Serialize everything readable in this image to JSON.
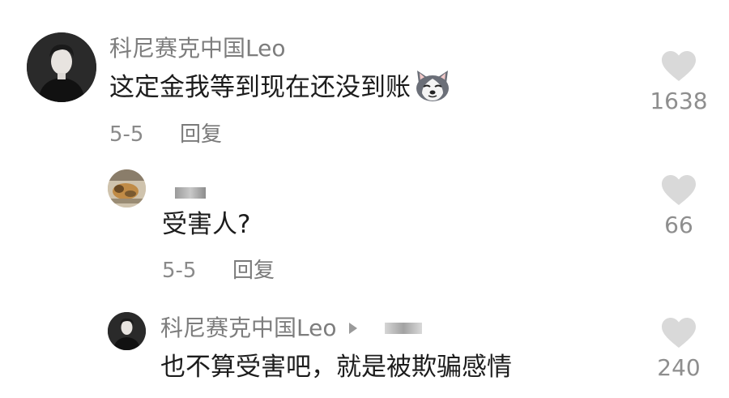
{
  "comments": [
    {
      "username": "科尼赛克中国Leo",
      "text": "这定金我等到现在还没到账",
      "emoji_icon": "husky-dog-emoji-icon",
      "date": "5-5",
      "reply_label": "回复",
      "likes": "1638"
    },
    {
      "username": "",
      "text": "受害人?",
      "date": "5-5",
      "reply_label": "回复",
      "likes": "66"
    },
    {
      "username": "科尼赛克中国Leo",
      "reply_to_arrow_icon": "play-arrow-icon",
      "text": "也不算受害吧，就是被欺骗感情",
      "likes": "240"
    }
  ],
  "colors": {
    "username": "#7d7d7d",
    "text": "#1c1c1c",
    "meta": "#8a8a8a",
    "heart": "#d9d9d9"
  }
}
